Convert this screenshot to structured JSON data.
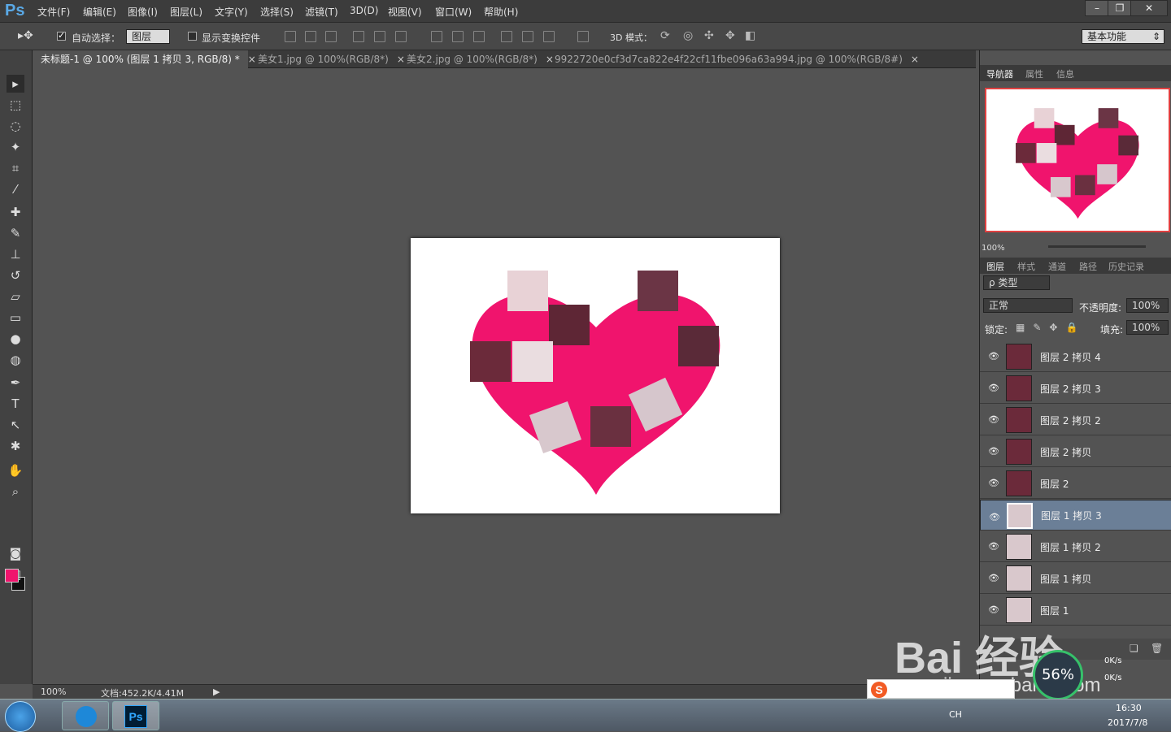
{
  "menubar": {
    "logo": "Ps",
    "items": [
      "文件(F)",
      "编辑(E)",
      "图像(I)",
      "图层(L)",
      "文字(Y)",
      "选择(S)",
      "滤镜(T)",
      "3D(D)",
      "视图(V)",
      "窗口(W)",
      "帮助(H)"
    ]
  },
  "options": {
    "auto_select_label": "自动选择：",
    "auto_select_value": "图层",
    "show_transform_label": "显示变换控件",
    "mode3d_label": "3D 模式：",
    "workspace": "基本功能"
  },
  "tabs": [
    {
      "label": "未标题-1 @ 100% (图层 1 拷贝 3, RGB/8) *"
    },
    {
      "label": "美女1.jpg @ 100%(RGB/8*)"
    },
    {
      "label": "美女2.jpg @ 100%(RGB/8*)"
    },
    {
      "label": "9922720e0cf3d7ca822e4f22cf11fbe096a63a994.jpg @ 100%(RGB/8#)"
    }
  ],
  "colors": {
    "foreground": "#f0146d",
    "background": "#111111",
    "heart": "#f0146d"
  },
  "status": {
    "zoom": "100%",
    "doc": "文档:452.2K/4.41M"
  },
  "navigator": {
    "tabs": [
      "导航器",
      "属性",
      "信息"
    ],
    "zoom": "100%"
  },
  "layers_panel": {
    "tabs": [
      "图层",
      "样式",
      "通道",
      "路径",
      "历史记录"
    ],
    "filter": "ρ 类型",
    "blend": "正常",
    "opacity_label": "不透明度:",
    "opacity": "100%",
    "lock_label": "锁定:",
    "fill_label": "填充:",
    "fill": "100%",
    "layers": [
      {
        "name": "图层 2 拷贝 4"
      },
      {
        "name": "图层 2 拷贝 3"
      },
      {
        "name": "图层 2 拷贝 2"
      },
      {
        "name": "图层 2 拷贝"
      },
      {
        "name": "图层 2"
      },
      {
        "name": "图层 1 拷贝 3"
      },
      {
        "name": "图层 1 拷贝 2"
      },
      {
        "name": "图层 1 拷贝"
      },
      {
        "name": "图层 1"
      }
    ]
  },
  "taskbar": {
    "lang": "CH",
    "time": "16:30",
    "date": "2017/7/8",
    "speed_up": "0K/s",
    "speed_down": "0K/s",
    "gauge": "56%"
  },
  "watermark": {
    "main": "Bai 经验",
    "url": "jingyan.baidu.com"
  }
}
